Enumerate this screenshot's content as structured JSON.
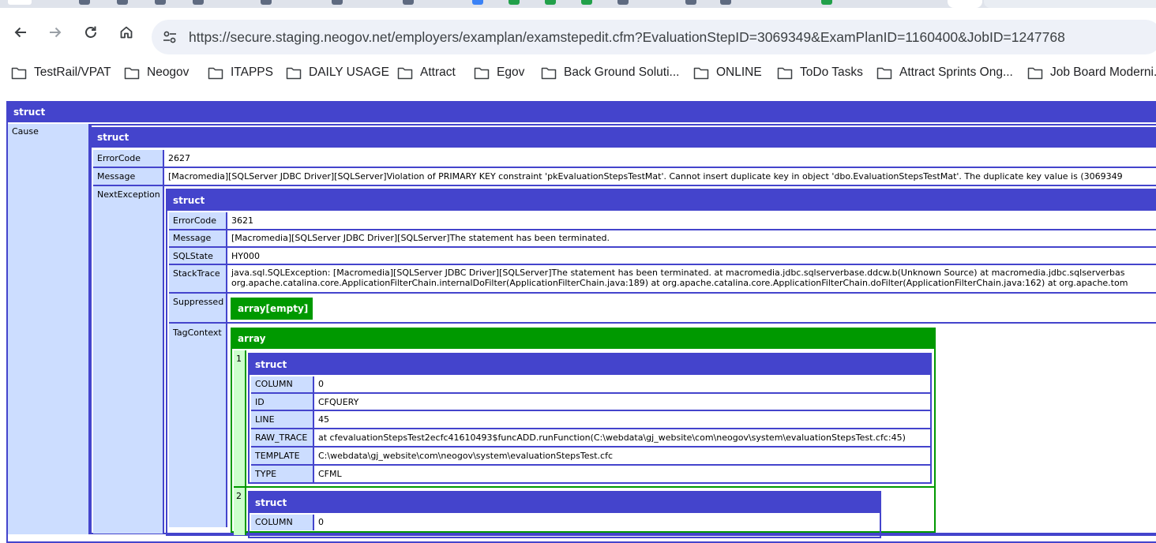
{
  "browser": {
    "url": "https://secure.staging.neogov.net/employers/examplan/examstepedit.cfm?EvaluationStepID=3069349&ExamPlanID=1160400&JobID=1247768",
    "bookmarks": [
      "TestRail/VPAT",
      "Neogov",
      "ITAPPS",
      "DAILY USAGE",
      "Attract",
      "Egov",
      "Back Ground Soluti...",
      "ONLINE",
      "ToDo Tasks",
      "Attract Sprints Ong...",
      "Job Board Moderni..."
    ],
    "icons": {
      "back": "arrow-left-icon",
      "forward": "arrow-right-icon",
      "reload": "reload-icon",
      "home": "home-icon",
      "site_info": "tune-icon",
      "folder": "folder-icon"
    }
  },
  "dump": {
    "root_label": "struct",
    "cause_key": "Cause",
    "cause": {
      "label": "struct",
      "error_code_key": "ErrorCode",
      "error_code": "2627",
      "message_key": "Message",
      "message": "[Macromedia][SQLServer JDBC Driver][SQLServer]Violation of PRIMARY KEY constraint 'pkEvaluationStepsTestMat'. Cannot insert duplicate key in object 'dbo.EvaluationStepsTestMat'. The duplicate key value is (3069349",
      "next_key": "NextException",
      "next": {
        "label": "struct",
        "error_code_key": "ErrorCode",
        "error_code": "3621",
        "message_key": "Message",
        "message": "[Macromedia][SQLServer JDBC Driver][SQLServer]The statement has been terminated.",
        "sqlstate_key": "SQLState",
        "sqlstate": "HY000",
        "stacktrace_key": "StackTrace",
        "stacktrace_line1": "java.sql.SQLException: [Macromedia][SQLServer JDBC Driver][SQLServer]The statement has been terminated. at macromedia.jdbc.sqlserverbase.ddcw.b(Unknown Source) at macromedia.jdbc.sqlserverbas",
        "stacktrace_line2": "org.apache.catalina.core.ApplicationFilterChain.internalDoFilter(ApplicationFilterChain.java:189) at org.apache.catalina.core.ApplicationFilterChain.doFilter(ApplicationFilterChain.java:162) at org.apache.tom",
        "suppressed_key": "Suppressed",
        "suppressed": "array[empty]",
        "tagcontext_key": "TagContext",
        "tagcontext": {
          "label": "array",
          "items": [
            {
              "index": "1",
              "label": "struct",
              "rows": [
                {
                  "key": "COLUMN",
                  "value": "0"
                },
                {
                  "key": "ID",
                  "value": "CFQUERY"
                },
                {
                  "key": "LINE",
                  "value": "45"
                },
                {
                  "key": "RAW_TRACE",
                  "value": "at cfevaluationStepsTest2ecfc41610493$funcADD.runFunction(C:\\webdata\\gj_website\\com\\neogov\\system\\evaluationStepsTest.cfc:45)"
                },
                {
                  "key": "TEMPLATE",
                  "value": "C:\\webdata\\gj_website\\com\\neogov\\system\\evaluationStepsTest.cfc"
                },
                {
                  "key": "TYPE",
                  "value": "CFML"
                }
              ]
            },
            {
              "index": "2",
              "label": "struct",
              "rows": [
                {
                  "key": "COLUMN",
                  "value": "0"
                }
              ]
            }
          ]
        }
      }
    }
  }
}
